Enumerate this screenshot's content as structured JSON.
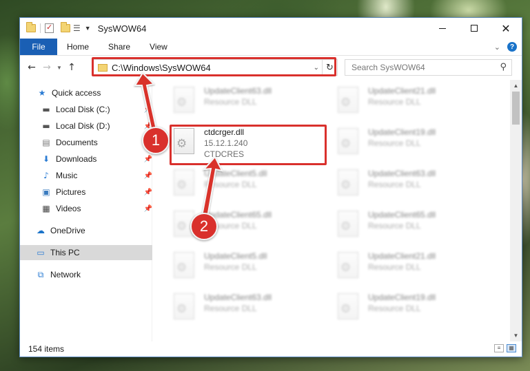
{
  "window": {
    "title": "SysWOW64",
    "controls": {
      "minimize": "—",
      "maximize": "□",
      "close": "✕"
    }
  },
  "ribbon": {
    "file_tab": "File",
    "tabs": [
      "Home",
      "Share",
      "View"
    ]
  },
  "nav": {
    "address": "C:\\Windows\\SysWOW64",
    "search_placeholder": "Search SysWOW64"
  },
  "sidebar": {
    "items": [
      {
        "label": "Quick access",
        "icon": "star-icon",
        "pinned": false
      },
      {
        "label": "Local Disk (C:)",
        "icon": "drive-icon",
        "pinned": true
      },
      {
        "label": "Local Disk (D:)",
        "icon": "drive-icon",
        "pinned": true
      },
      {
        "label": "Documents",
        "icon": "document-icon",
        "pinned": true
      },
      {
        "label": "Downloads",
        "icon": "download-icon",
        "pinned": true
      },
      {
        "label": "Music",
        "icon": "music-icon",
        "pinned": true
      },
      {
        "label": "Pictures",
        "icon": "pictures-icon",
        "pinned": true
      },
      {
        "label": "Videos",
        "icon": "video-icon",
        "pinned": true
      },
      {
        "label": "OneDrive",
        "icon": "cloud-icon",
        "pinned": false
      },
      {
        "label": "This PC",
        "icon": "computer-icon",
        "pinned": false,
        "selected": true
      },
      {
        "label": "Network",
        "icon": "network-icon",
        "pinned": false
      }
    ]
  },
  "files": {
    "highlighted": {
      "name": "ctdcrger.dll",
      "version": "15.12.1.240",
      "company": "CTDCRES"
    },
    "blurred_left": [
      {
        "name": "UpdateClient63.dll",
        "type": "Resource DLL"
      },
      {
        "name": "UpdateClient5.dll",
        "type": "Resource DLL"
      },
      {
        "name": "UpdateClient65.dll",
        "type": "Resource DLL"
      },
      {
        "name": "UpdateClient5.dll",
        "type": "Resource DLL"
      },
      {
        "name": "UpdateClient63.dll",
        "type": "Resource DLL"
      }
    ],
    "blurred_right": [
      {
        "name": "UpdateClient21.dll",
        "type": "Resource DLL"
      },
      {
        "name": "UpdateClient19.dll",
        "type": "Resource DLL"
      },
      {
        "name": "UpdateClient63.dll",
        "type": "Resource DLL"
      },
      {
        "name": "UpdateClient65.dll",
        "type": "Resource DLL"
      },
      {
        "name": "UpdateClient21.dll",
        "type": "Resource DLL"
      },
      {
        "name": "UpdateClient19.dll",
        "type": "Resource DLL"
      }
    ]
  },
  "status": {
    "item_count": "154 items"
  },
  "callouts": {
    "step1": "1",
    "step2": "2"
  },
  "colors": {
    "accent": "#1a5fb4",
    "highlight": "#d9302c"
  }
}
